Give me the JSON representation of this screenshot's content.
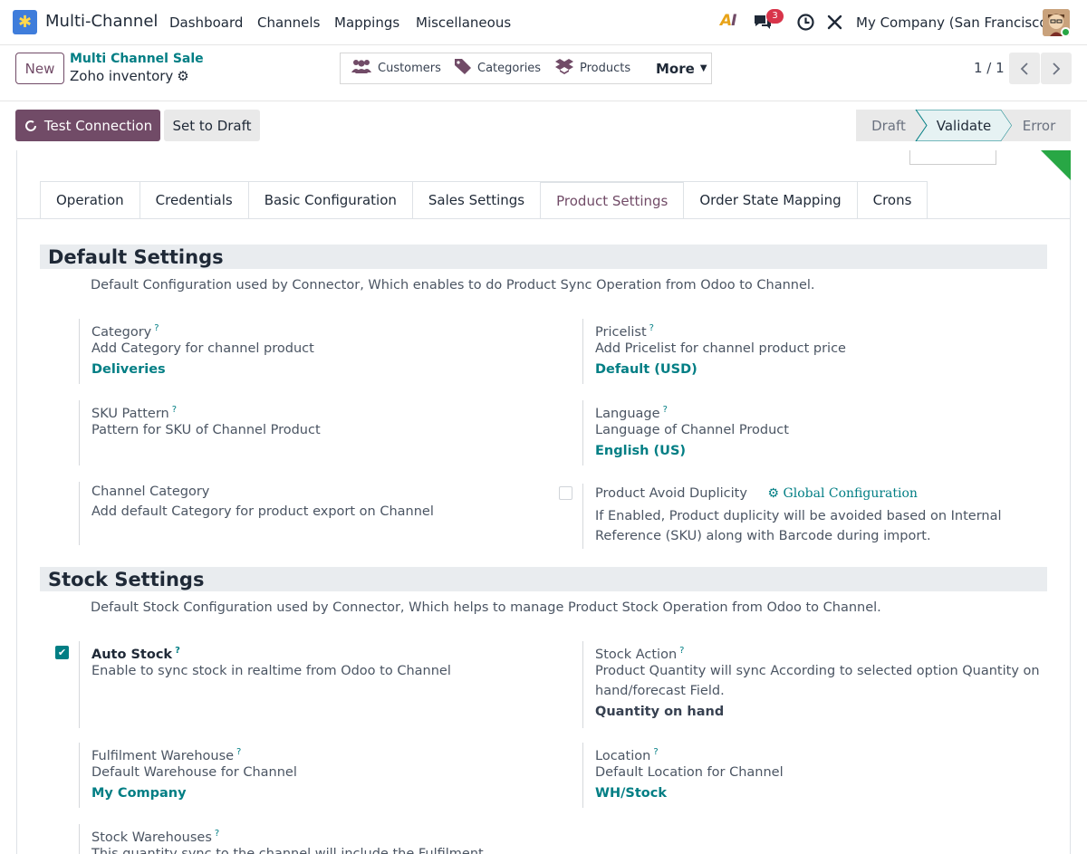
{
  "nav": {
    "app_name": "Multi-Channel",
    "menu": [
      "Dashboard",
      "Channels",
      "Mappings",
      "Miscellaneous"
    ],
    "chat_badge": "3",
    "company": "My Company (San Francisco)"
  },
  "control": {
    "new_label": "New",
    "breadcrumb": "Multi Channel Sale",
    "record_name": "Zoho inventory",
    "smart_buttons": [
      "Customers",
      "Categories",
      "Products"
    ],
    "more_label": "More",
    "pager": "1 / 1"
  },
  "statusbar": {
    "test_label": "Test Connection",
    "draft_label": "Set to Draft",
    "stages": [
      "Draft",
      "Validate",
      "Error"
    ],
    "active_stage": "Validate"
  },
  "tabs": [
    "Operation",
    "Credentials",
    "Basic Configuration",
    "Sales Settings",
    "Product Settings",
    "Order State Mapping",
    "Crons"
  ],
  "active_tab": "Product Settings",
  "default_settings": {
    "title": "Default Settings",
    "description": "Default Configuration used by Connector, Which enables to do Product Sync Operation from Odoo to Channel.",
    "category": {
      "label": "Category",
      "help": "Add Category for channel product",
      "value": "Deliveries"
    },
    "pricelist": {
      "label": "Pricelist",
      "help": "Add Pricelist for channel product price",
      "value": "Default (USD)"
    },
    "sku": {
      "label": "SKU Pattern",
      "help": "Pattern for SKU of Channel Product"
    },
    "language": {
      "label": "Language",
      "help": "Language of Channel Product",
      "value": "English (US)"
    },
    "channel_category": {
      "label": "Channel Category",
      "help": "Add default Category for product export on Channel"
    },
    "avoid_dup": {
      "label": "Product Avoid Duplicity",
      "link": "Global Configuration",
      "help_1": "If Enabled, Product duplicity will be avoided based on Internal",
      "help_2": "Reference (SKU) along with Barcode during import.",
      "checked": false
    }
  },
  "stock_settings": {
    "title": "Stock Settings",
    "description": "Default Stock Configuration used by Connector, Which helps to manage Product Stock Operation from Odoo to Channel.",
    "auto_stock": {
      "label": "Auto Stock",
      "help": "Enable to sync stock in realtime from Odoo to Channel",
      "checked": true
    },
    "stock_action": {
      "label": "Stock Action",
      "help_1": "Product Quantity will sync According to selected option Quantity on",
      "help_2": "hand/forecast Field.",
      "value": "Quantity on hand"
    },
    "fulfilment": {
      "label": "Fulfilment Warehouse",
      "help": "Default Warehouse for Channel",
      "value": "My Company"
    },
    "location": {
      "label": "Location",
      "help": "Default Location for Channel",
      "value": "WH/Stock"
    },
    "stock_warehouses": {
      "label": "Stock Warehouses",
      "help": "This quantity sync to the channel will include the Fulfilment"
    }
  }
}
